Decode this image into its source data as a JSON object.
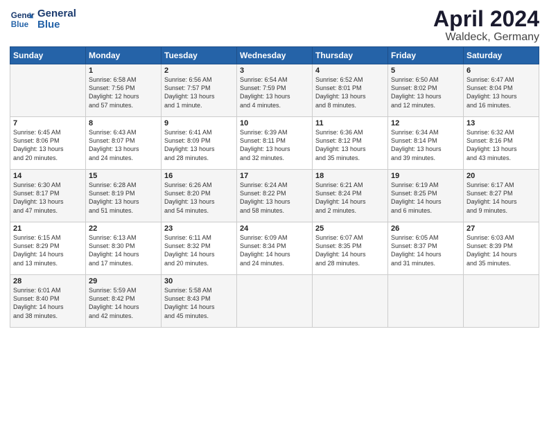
{
  "logo": {
    "line1": "General",
    "line2": "Blue"
  },
  "title": "April 2024",
  "location": "Waldeck, Germany",
  "days_header": [
    "Sunday",
    "Monday",
    "Tuesday",
    "Wednesday",
    "Thursday",
    "Friday",
    "Saturday"
  ],
  "weeks": [
    [
      {
        "day": "",
        "info": ""
      },
      {
        "day": "1",
        "info": "Sunrise: 6:58 AM\nSunset: 7:56 PM\nDaylight: 12 hours\nand 57 minutes."
      },
      {
        "day": "2",
        "info": "Sunrise: 6:56 AM\nSunset: 7:57 PM\nDaylight: 13 hours\nand 1 minute."
      },
      {
        "day": "3",
        "info": "Sunrise: 6:54 AM\nSunset: 7:59 PM\nDaylight: 13 hours\nand 4 minutes."
      },
      {
        "day": "4",
        "info": "Sunrise: 6:52 AM\nSunset: 8:01 PM\nDaylight: 13 hours\nand 8 minutes."
      },
      {
        "day": "5",
        "info": "Sunrise: 6:50 AM\nSunset: 8:02 PM\nDaylight: 13 hours\nand 12 minutes."
      },
      {
        "day": "6",
        "info": "Sunrise: 6:47 AM\nSunset: 8:04 PM\nDaylight: 13 hours\nand 16 minutes."
      }
    ],
    [
      {
        "day": "7",
        "info": "Sunrise: 6:45 AM\nSunset: 8:06 PM\nDaylight: 13 hours\nand 20 minutes."
      },
      {
        "day": "8",
        "info": "Sunrise: 6:43 AM\nSunset: 8:07 PM\nDaylight: 13 hours\nand 24 minutes."
      },
      {
        "day": "9",
        "info": "Sunrise: 6:41 AM\nSunset: 8:09 PM\nDaylight: 13 hours\nand 28 minutes."
      },
      {
        "day": "10",
        "info": "Sunrise: 6:39 AM\nSunset: 8:11 PM\nDaylight: 13 hours\nand 32 minutes."
      },
      {
        "day": "11",
        "info": "Sunrise: 6:36 AM\nSunset: 8:12 PM\nDaylight: 13 hours\nand 35 minutes."
      },
      {
        "day": "12",
        "info": "Sunrise: 6:34 AM\nSunset: 8:14 PM\nDaylight: 13 hours\nand 39 minutes."
      },
      {
        "day": "13",
        "info": "Sunrise: 6:32 AM\nSunset: 8:16 PM\nDaylight: 13 hours\nand 43 minutes."
      }
    ],
    [
      {
        "day": "14",
        "info": "Sunrise: 6:30 AM\nSunset: 8:17 PM\nDaylight: 13 hours\nand 47 minutes."
      },
      {
        "day": "15",
        "info": "Sunrise: 6:28 AM\nSunset: 8:19 PM\nDaylight: 13 hours\nand 51 minutes."
      },
      {
        "day": "16",
        "info": "Sunrise: 6:26 AM\nSunset: 8:20 PM\nDaylight: 13 hours\nand 54 minutes."
      },
      {
        "day": "17",
        "info": "Sunrise: 6:24 AM\nSunset: 8:22 PM\nDaylight: 13 hours\nand 58 minutes."
      },
      {
        "day": "18",
        "info": "Sunrise: 6:21 AM\nSunset: 8:24 PM\nDaylight: 14 hours\nand 2 minutes."
      },
      {
        "day": "19",
        "info": "Sunrise: 6:19 AM\nSunset: 8:25 PM\nDaylight: 14 hours\nand 6 minutes."
      },
      {
        "day": "20",
        "info": "Sunrise: 6:17 AM\nSunset: 8:27 PM\nDaylight: 14 hours\nand 9 minutes."
      }
    ],
    [
      {
        "day": "21",
        "info": "Sunrise: 6:15 AM\nSunset: 8:29 PM\nDaylight: 14 hours\nand 13 minutes."
      },
      {
        "day": "22",
        "info": "Sunrise: 6:13 AM\nSunset: 8:30 PM\nDaylight: 14 hours\nand 17 minutes."
      },
      {
        "day": "23",
        "info": "Sunrise: 6:11 AM\nSunset: 8:32 PM\nDaylight: 14 hours\nand 20 minutes."
      },
      {
        "day": "24",
        "info": "Sunrise: 6:09 AM\nSunset: 8:34 PM\nDaylight: 14 hours\nand 24 minutes."
      },
      {
        "day": "25",
        "info": "Sunrise: 6:07 AM\nSunset: 8:35 PM\nDaylight: 14 hours\nand 28 minutes."
      },
      {
        "day": "26",
        "info": "Sunrise: 6:05 AM\nSunset: 8:37 PM\nDaylight: 14 hours\nand 31 minutes."
      },
      {
        "day": "27",
        "info": "Sunrise: 6:03 AM\nSunset: 8:39 PM\nDaylight: 14 hours\nand 35 minutes."
      }
    ],
    [
      {
        "day": "28",
        "info": "Sunrise: 6:01 AM\nSunset: 8:40 PM\nDaylight: 14 hours\nand 38 minutes."
      },
      {
        "day": "29",
        "info": "Sunrise: 5:59 AM\nSunset: 8:42 PM\nDaylight: 14 hours\nand 42 minutes."
      },
      {
        "day": "30",
        "info": "Sunrise: 5:58 AM\nSunset: 8:43 PM\nDaylight: 14 hours\nand 45 minutes."
      },
      {
        "day": "",
        "info": ""
      },
      {
        "day": "",
        "info": ""
      },
      {
        "day": "",
        "info": ""
      },
      {
        "day": "",
        "info": ""
      }
    ]
  ]
}
